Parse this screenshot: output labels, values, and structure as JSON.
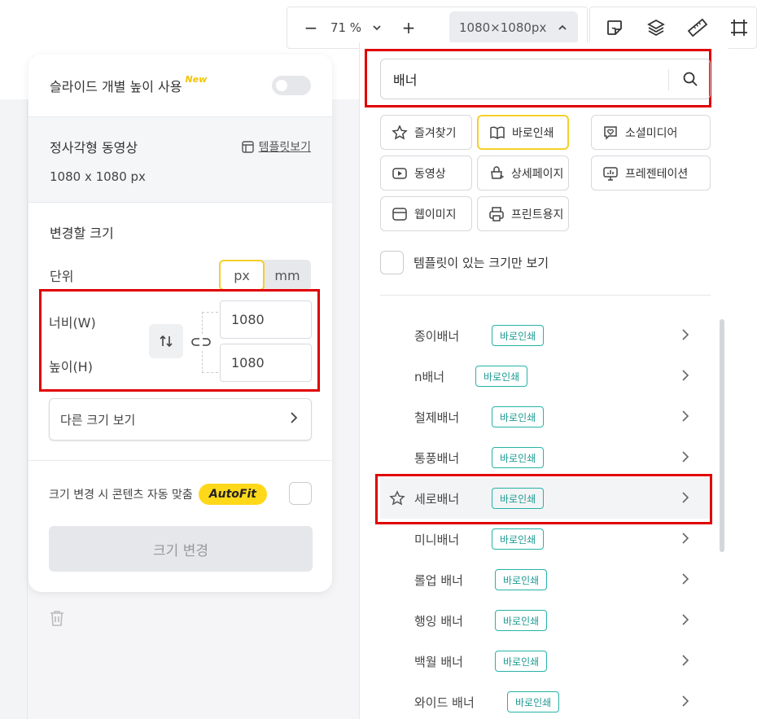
{
  "toolbar": {
    "zoom_out": "−",
    "zoom_value": "71 %",
    "zoom_in": "+",
    "canvas_size": "1080×1080px"
  },
  "tools": [
    "sticker-icon",
    "layers-icon",
    "ruler-icon",
    "crop-icon"
  ],
  "left_panel": {
    "individual_height_label": "슬라이드 개별 높이 사용",
    "new_tag": "New",
    "current_name": "정사각형 동영상",
    "current_dims": "1080 x 1080 px",
    "template_link": "템플릿보기",
    "change_title": "변경할 크기",
    "unit_label": "단위",
    "unit_px": "px",
    "unit_mm": "mm",
    "width_label": "너비(W)",
    "height_label": "높이(H)",
    "width_value": "1080",
    "height_value": "1080",
    "other_sizes": "다른 크기 보기",
    "autofit_label": "크기 변경 시 콘텐츠 자동 맞춤",
    "autofit_badge": "AutoFit",
    "apply_button": "크기 변경"
  },
  "right_panel": {
    "search_value": "배너",
    "categories": [
      {
        "label": "즐겨찾기",
        "icon": "star-icon"
      },
      {
        "label": "바로인쇄",
        "icon": "book-icon"
      },
      {
        "label": "소셜미디어",
        "icon": "social-icon"
      },
      {
        "label": "동영상",
        "icon": "video-icon"
      },
      {
        "label": "상세페이지",
        "icon": "cart-icon"
      },
      {
        "label": "프레젠테이션",
        "icon": "presentation-icon"
      },
      {
        "label": "웹이미지",
        "icon": "browser-icon"
      },
      {
        "label": "프린트용지",
        "icon": "printer-icon"
      }
    ],
    "template_only": "템플릿이 있는 크기만 보기",
    "items": [
      {
        "label": "종이배너",
        "badge": "바로인쇄"
      },
      {
        "label": "n배너",
        "badge": "바로인쇄"
      },
      {
        "label": "철제배너",
        "badge": "바로인쇄"
      },
      {
        "label": "통풍배너",
        "badge": "바로인쇄"
      },
      {
        "label": "세로배너",
        "badge": "바로인쇄"
      },
      {
        "label": "미니배너",
        "badge": "바로인쇄"
      },
      {
        "label": "롤업 배너",
        "badge": "바로인쇄"
      },
      {
        "label": "행잉 배너",
        "badge": "바로인쇄"
      },
      {
        "label": "백월 배너",
        "badge": "바로인쇄"
      },
      {
        "label": "와이드 배너",
        "badge": "바로인쇄"
      }
    ]
  }
}
